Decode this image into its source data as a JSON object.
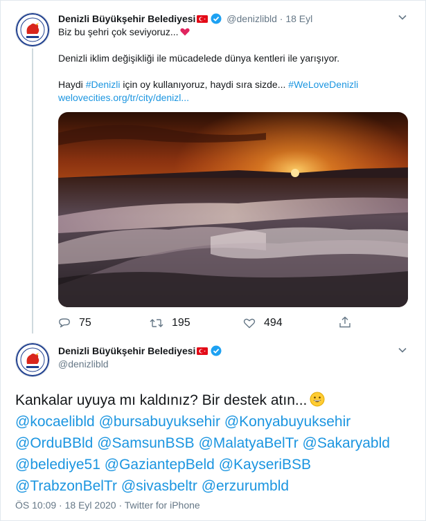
{
  "tweet1": {
    "author_name": "Denizli Büyükşehir Belediyesi",
    "handle": "@denizlibld",
    "separator": "·",
    "date": "18 Eyl",
    "line1": "Biz bu şehri çok seviyoruz...",
    "line2": "Denizli iklim değişikliği ile mücadelede dünya kentleri ile yarışıyor.",
    "line3_prefix": "Haydi ",
    "line3_hashtag1": "#Denizli",
    "line3_middle": " için oy kullanıyoruz, haydi sıra sizde... ",
    "line3_hashtag2": "#WeLoveDenizli",
    "link": "welovecities.org/tr/city/denizl...",
    "replies": "75",
    "retweets": "195",
    "likes": "494",
    "photo_alt": "Pamukkale travertines at sunset"
  },
  "tweet2": {
    "author_name": "Denizli Büyükşehir Belediyesi",
    "handle": "@denizlibld",
    "text": "Kankalar uyuya mı kaldınız? Bir destek atın...",
    "mentions": [
      [
        "@kocaelibld",
        "@bursabuyuksehir",
        "@Konyabuyuksehir"
      ],
      [
        "@OrduBBld",
        "@SamsunBSB",
        "@MalatyaBelTr",
        "@Sakaryabld"
      ],
      [
        "@belediye51",
        "@GaziantepBeld",
        "@KayseriBSB"
      ],
      [
        "@TrabzonBelTr",
        "@sivasbeltr",
        "@erzurumbld"
      ]
    ],
    "time": "ÖS 10:09",
    "separator": "·",
    "date": "18 Eyl 2020",
    "source_sep": "·",
    "source": "Twitter for iPhone"
  },
  "colors": {
    "link": "#1b95e0",
    "muted": "#657786",
    "verified": "#1da1f2",
    "flag": "#e30a17"
  },
  "icons": [
    "reply-icon",
    "retweet-icon",
    "like-icon",
    "share-icon",
    "verified-icon",
    "turkish-flag-icon",
    "chevron-down-icon"
  ]
}
